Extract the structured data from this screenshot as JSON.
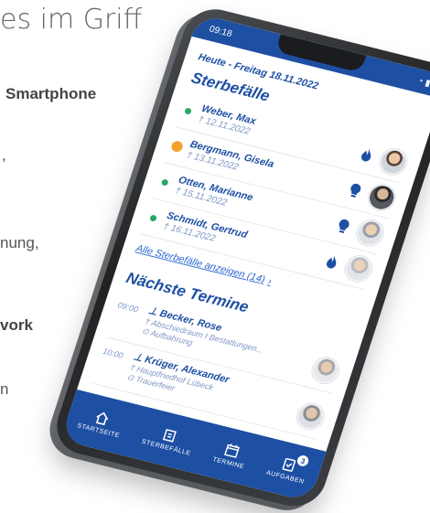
{
  "copy": {
    "headline": "es im Griff",
    "line1": "Smartphone",
    "line2": ",",
    "line3": "nung,",
    "line4": "vork",
    "line5": "n"
  },
  "status": {
    "time": "09:18"
  },
  "app": {
    "date_label": "Heute - Freitag 18.11.2022",
    "deaths_title": "Sterbefälle",
    "deaths": [
      {
        "name": "Weber, Max",
        "date": "† 12.11.2022",
        "status": "green",
        "icon": "flame-icon"
      },
      {
        "name": "Bergmann, Gisela",
        "date": "† 13.11.2022",
        "status": "orange",
        "icon": "lightbulb-icon"
      },
      {
        "name": "Otten, Marianne",
        "date": "† 15.11.2022",
        "status": "green",
        "icon": "lightbulb-icon"
      },
      {
        "name": "Schmidt, Gertrud",
        "date": "† 16.11.2022",
        "status": "green",
        "icon": "flame-icon"
      }
    ],
    "show_all_link": "Alle Sterbefälle anzeigen (14)",
    "show_all_arrow": "›",
    "appointments_title": "Nächste Termine",
    "appointments": [
      {
        "time": "09:00",
        "name": "⊥ Becker, Rose",
        "place": "† Abschiedraum I Bestattungen...",
        "type": "⊙ Aufbahrung"
      },
      {
        "time": "10:00",
        "name": "⊥ Krüger, Alexander",
        "place": "† Hauptfriedhof Lübeck",
        "type": "⊙ Trauerfeier"
      }
    ]
  },
  "tabs": [
    {
      "label": "STARTSEITE",
      "icon": "home-icon"
    },
    {
      "label": "STERBEFÄLLE",
      "icon": "deaths-icon"
    },
    {
      "label": "TERMINE",
      "icon": "calendar-icon"
    },
    {
      "label": "AUFGABEN",
      "icon": "tasks-icon",
      "badge": "3"
    }
  ],
  "colors": {
    "brand": "#1d4fa3",
    "green": "#27a86a",
    "orange": "#f1a22b"
  }
}
